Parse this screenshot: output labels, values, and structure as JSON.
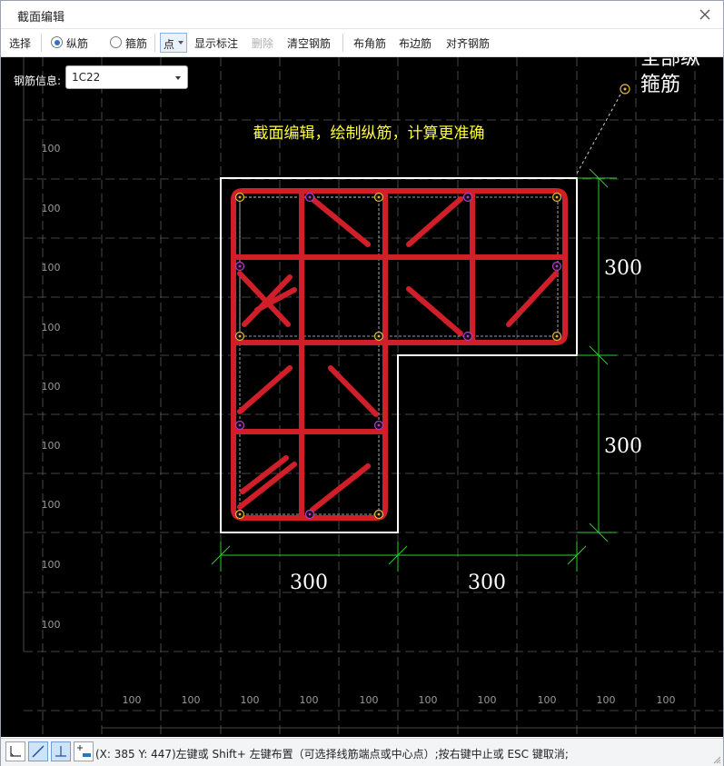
{
  "window": {
    "title": "截面编辑"
  },
  "toolbar": {
    "select": "选择",
    "longitudinal": "纵筋",
    "stirrup": "箍筋",
    "mode": "点",
    "show_labels": "显示标注",
    "delete": "删除",
    "clear_rebar": "清空钢筋",
    "corner_rebar": "布角筋",
    "side_rebar": "布边筋",
    "align_rebar": "对齐钢筋"
  },
  "canvas": {
    "rebar_info_label": "钢筋信息:",
    "rebar_info_value": "1C22",
    "hint": "截面编辑，绘制纵筋，计算更准确",
    "callout_top": "全部纵",
    "callout_stirrup": "箍筋",
    "dims": {
      "right_upper": "300",
      "right_lower": "300",
      "bottom_left": "300",
      "bottom_right": "300"
    },
    "grid_label": "100",
    "colors": {
      "rebar": "#d11f2a",
      "outline": "#ffffff",
      "dim": "#2fcc2f",
      "hint": "#ffff33",
      "grid": "#5a5a5a"
    }
  },
  "statusbar": {
    "text": "(X: 385 Y: 447)左键或 Shift+ 左键布置（可选择线筋端点或中心点）;按右键中止或 ESC 键取消;",
    "tools": [
      "orthogonal-icon",
      "line-icon",
      "perpendicular-icon",
      "offset-icon"
    ]
  }
}
